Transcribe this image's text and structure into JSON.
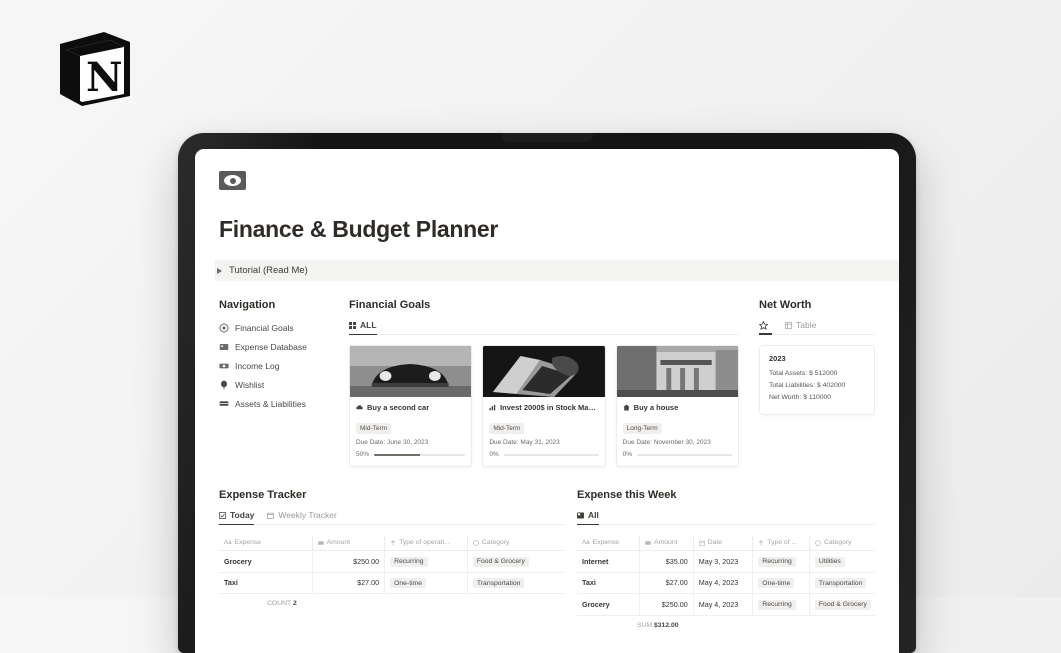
{
  "brand": {
    "logo_name": "notion-logo",
    "letter": "N"
  },
  "page": {
    "icon_name": "banknote-icon",
    "title": "Finance & Budget Planner",
    "toggle_label": "Tutorial (Read Me)"
  },
  "navigation": {
    "title": "Navigation",
    "items": [
      {
        "label": "Financial Goals",
        "icon": "target-icon"
      },
      {
        "label": "Expense Database",
        "icon": "card-icon"
      },
      {
        "label": "Income Log",
        "icon": "money-icon"
      },
      {
        "label": "Wishlist",
        "icon": "balloon-icon"
      },
      {
        "label": "Assets & Liabilities",
        "icon": "stack-icon"
      }
    ]
  },
  "financial_goals": {
    "title": "Financial Goals",
    "tabs": [
      {
        "label": "ALL",
        "icon": "gallery-icon",
        "active": true
      }
    ],
    "cards": [
      {
        "title": "Buy a second car",
        "icon": "car-icon",
        "term": "Mid-Term",
        "due": "Due Date: June 30, 2023",
        "progress_label": "50%",
        "progress": 50,
        "photo": "vintage-car-photo"
      },
      {
        "title": "Invest 2000$ in Stock Market",
        "icon": "chart-icon",
        "term": "Mid-Term",
        "due": "Due Date: May 31, 2023",
        "progress_label": "0%",
        "progress": 0,
        "photo": "laptop-hands-photo"
      },
      {
        "title": "Buy a house",
        "icon": "house-icon",
        "term": "Long-Term",
        "due": "Due Date: November 30, 2023",
        "progress_label": "0%",
        "progress": 0,
        "photo": "house-photo"
      }
    ]
  },
  "net_worth": {
    "title": "Net Worth",
    "tabs": [
      {
        "label": "",
        "icon": "star-icon",
        "active": true
      },
      {
        "label": "Table",
        "icon": "table-icon",
        "active": false
      }
    ],
    "card": {
      "year": "2023",
      "total_assets": "Total Assets: $ 512000",
      "total_liabilities": "Total Liabilities: $ 402000",
      "net_worth": "Net Worth: $ 110000"
    }
  },
  "expense_tracker": {
    "title": "Expense Tracker",
    "tabs": [
      {
        "label": "Today",
        "icon": "check-square-icon",
        "active": true
      },
      {
        "label": "Weekly Tracker",
        "icon": "calendar-icon",
        "active": false
      }
    ],
    "columns": [
      {
        "label": "Expense",
        "icon": "Aa"
      },
      {
        "label": "Amount",
        "icon": "number-icon"
      },
      {
        "label": "Type of operati...",
        "icon": "select-icon"
      },
      {
        "label": "Category",
        "icon": "circle-icon"
      }
    ],
    "rows": [
      {
        "expense": "Grocery",
        "amount": "$250.00",
        "type": "Recurring",
        "category": "Food & Grocery"
      },
      {
        "expense": "Taxi",
        "amount": "$27.00",
        "type": "One-time",
        "category": "Transportation"
      }
    ],
    "footer": {
      "label": "COUNT",
      "value": "2"
    }
  },
  "expense_week": {
    "title": "Expense this Week",
    "tabs": [
      {
        "label": "All",
        "icon": "gallery-icon",
        "active": true
      }
    ],
    "columns": [
      {
        "label": "Expense",
        "icon": "Aa"
      },
      {
        "label": "Amount",
        "icon": "number-icon"
      },
      {
        "label": "Date",
        "icon": "calendar-icon"
      },
      {
        "label": "Type of ...",
        "icon": "select-icon"
      },
      {
        "label": "Category",
        "icon": "circle-icon"
      }
    ],
    "rows": [
      {
        "expense": "Internet",
        "amount": "$35.00",
        "date": "May 3, 2023",
        "type": "Recurring",
        "category": "Utilities"
      },
      {
        "expense": "Taxi",
        "amount": "$27.00",
        "date": "May 4, 2023",
        "type": "One-time",
        "category": "Transportation"
      },
      {
        "expense": "Grocery",
        "amount": "$250.00",
        "date": "May 4, 2023",
        "type": "Recurring",
        "category": "Food & Grocery"
      }
    ],
    "footer": {
      "label": "SUM",
      "value": "$312.00"
    }
  }
}
